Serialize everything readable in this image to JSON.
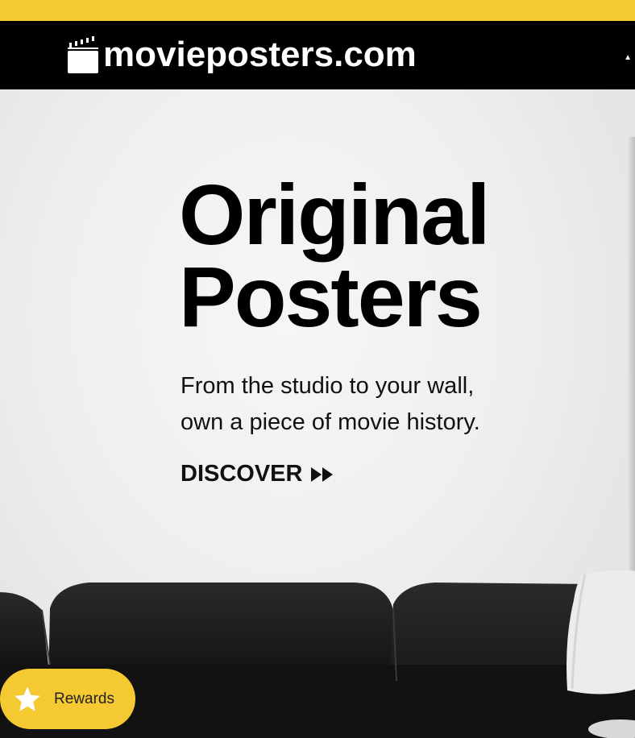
{
  "brand": {
    "name": "movieposters.com",
    "accent_color": "#f5c932"
  },
  "hero": {
    "headline_line1": "Original",
    "headline_line2": "Posters",
    "subtext_line1": "From the studio to your wall,",
    "subtext_line2": "own a piece of movie history.",
    "cta_label": "DISCOVER",
    "cta_icon": "fast-forward-icon"
  },
  "rewards": {
    "label": "Rewards",
    "icon": "star-icon"
  },
  "icons": {
    "logo": "clapperboard-icon"
  }
}
